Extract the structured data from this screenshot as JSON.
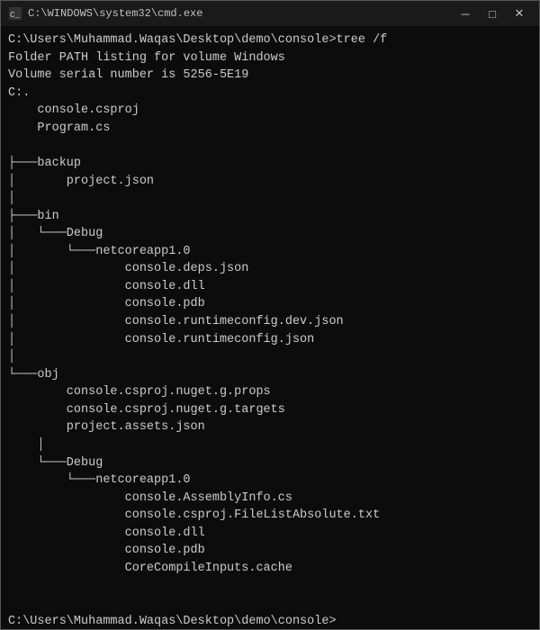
{
  "window": {
    "title": "C:\\WINDOWS\\system32\\cmd.exe",
    "minimize_label": "─",
    "maximize_label": "□",
    "close_label": "✕"
  },
  "console": {
    "lines": [
      "C:\\Users\\Muhammad.Waqas\\Desktop\\demo\\console>tree /f",
      "Folder PATH listing for volume Windows",
      "Volume serial number is 5256-5E19",
      "C:.",
      "    console.csproj",
      "    Program.cs",
      "    ",
      "├───backup",
      "│       project.json",
      "│   ",
      "├───bin",
      "│   └───Debug",
      "│       └───netcoreapp1.0",
      "│               console.deps.json",
      "│               console.dll",
      "│               console.pdb",
      "│               console.runtimeconfig.dev.json",
      "│               console.runtimeconfig.json",
      "│   ",
      "└───obj",
      "        console.csproj.nuget.g.props",
      "        console.csproj.nuget.g.targets",
      "        project.assets.json",
      "    │   ",
      "    └───Debug",
      "        └───netcoreapp1.0",
      "                console.AssemblyInfo.cs",
      "                console.csproj.FileListAbsolute.txt",
      "                console.dll",
      "                console.pdb",
      "                CoreCompileInputs.cache",
      " ",
      " ",
      "C:\\Users\\Muhammad.Waqas\\Desktop\\demo\\console>"
    ]
  }
}
